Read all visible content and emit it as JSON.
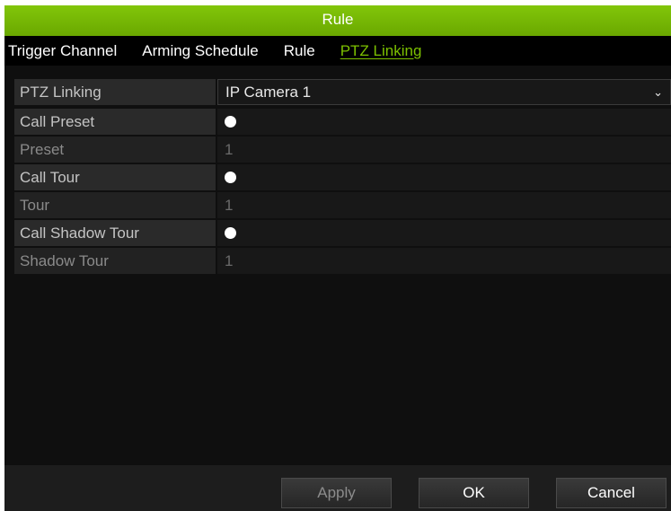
{
  "dialog": {
    "title": "Rule"
  },
  "tabs": [
    {
      "label": "Trigger Channel",
      "active": false
    },
    {
      "label": "Arming Schedule",
      "active": false
    },
    {
      "label": "Rule",
      "active": false
    },
    {
      "label": "PTZ Linking",
      "active": true
    }
  ],
  "form": {
    "ptz_linking": {
      "label": "PTZ Linking",
      "value": "IP Camera 1"
    },
    "call_preset": {
      "label": "Call Preset",
      "checked": false
    },
    "preset": {
      "label": "Preset",
      "value": "1"
    },
    "call_tour": {
      "label": "Call Tour",
      "checked": false
    },
    "tour": {
      "label": "Tour",
      "value": "1"
    },
    "call_shadow_tour": {
      "label": "Call Shadow Tour",
      "checked": false
    },
    "shadow_tour": {
      "label": "Shadow Tour",
      "value": "1"
    }
  },
  "buttons": {
    "apply": "Apply",
    "ok": "OK",
    "cancel": "Cancel"
  },
  "colors": {
    "accent": "#7cc000",
    "titlebar": "#6aa800",
    "background": "#0f0f0f"
  },
  "icons": {
    "dropdown": "chevron-down-icon",
    "radio": "radio-icon"
  }
}
